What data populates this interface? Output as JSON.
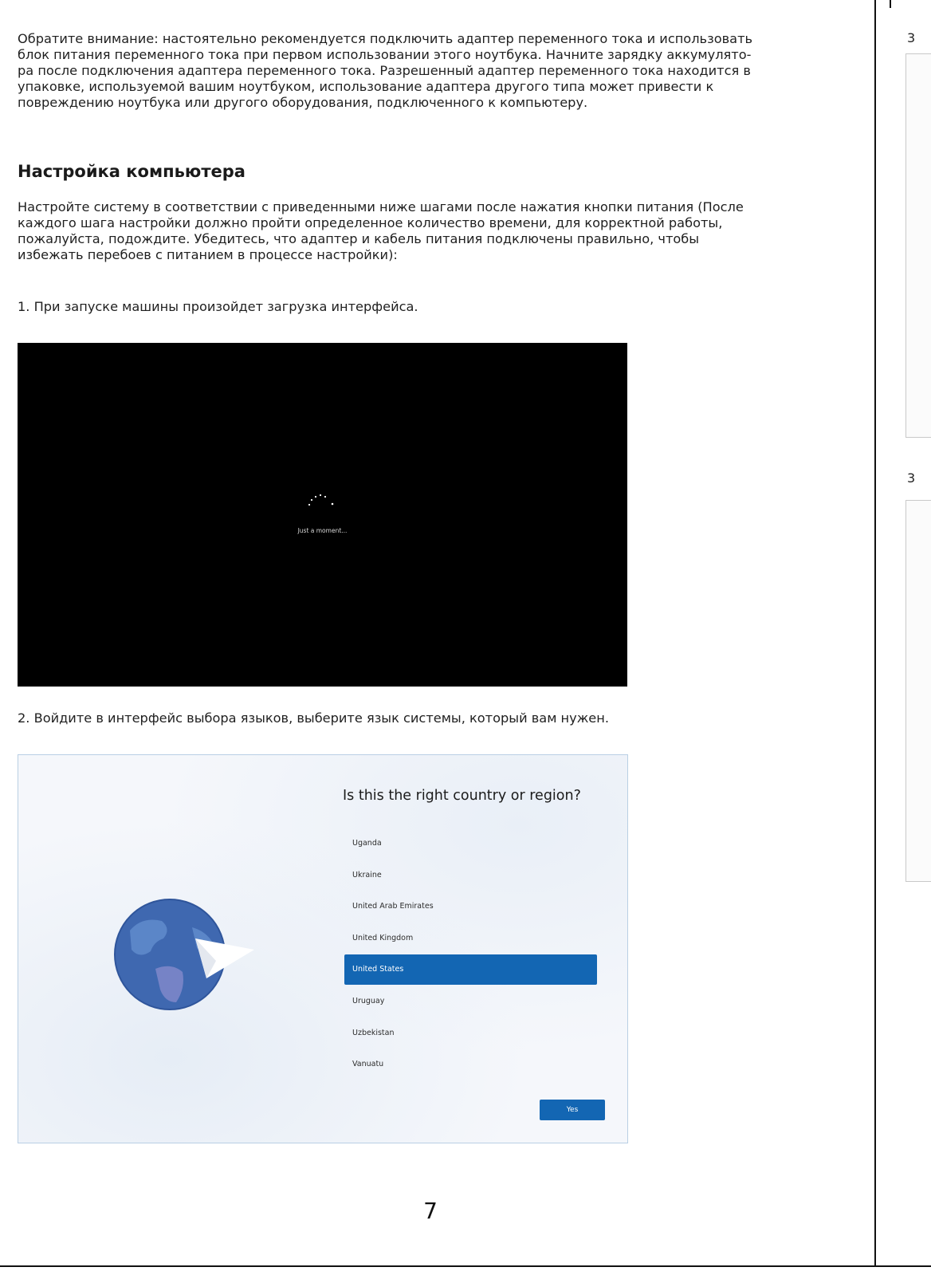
{
  "intro": "Обратите внимание: настоятельно рекомендуется подключить адаптер переменного тока и использовать блок питания переменного тока при первом использовании этого ноутбука. Начните зарядку аккумулято-ра после подключения адаптера переменного тока. Разрешенный адаптер переменного тока находится в упаковке, используемой вашим ноутбуком, использование адаптера другого типа может привести к повреждению ноутбука или другого оборудования, подключенного к компьютеру.",
  "intro_lines": [
    "Обратите внимание: настоятельно рекомендуется подключить адаптер переменного тока и использовать",
    "блок питания переменного тока при первом использовании этого ноутбука. Начните зарядку аккумулято-",
    "ра после подключения адаптера переменного тока. Разрешенный адаптер переменного тока находится в",
    "упаковке, используемой вашим ноутбуком, использование адаптера другого типа может привести к",
    "повреждению ноутбука или другого оборудования, подключенного к компьютеру."
  ],
  "heading": "Настройка компьютера",
  "setup_lines": [
    "Настройте систему в соответствии с приведенными ниже шагами после нажатия кнопки питания (После",
    "каждого шага настройки должно пройти определенное количество времени, для корректной работы,",
    "пожалуйста, подождите. Убедитесь, что адаптер и кабель питания подключены правильно, чтобы",
    "избежать перебоев с питанием в процессе настройки):"
  ],
  "step1": "1. При запуске машины произойдет загрузка интерфейса.",
  "loading_text": "Just a moment...",
  "step2": "2. Войдите в интерфейс выбора языков, выберите язык системы, который вам нужен.",
  "region": {
    "question": "Is this the right country or region?",
    "countries": [
      "Uganda",
      "Ukraine",
      "United Arab Emirates",
      "United Kingdom",
      "United States",
      "Uruguay",
      "Uzbekistan",
      "Vanuatu"
    ],
    "selected": "United States",
    "yes_label": "Yes"
  },
  "right_page": {
    "label_1": "3",
    "label_2": "3"
  },
  "page_number": "7",
  "colors": {
    "accent": "#1366b3",
    "globe": "#3f68b0"
  }
}
